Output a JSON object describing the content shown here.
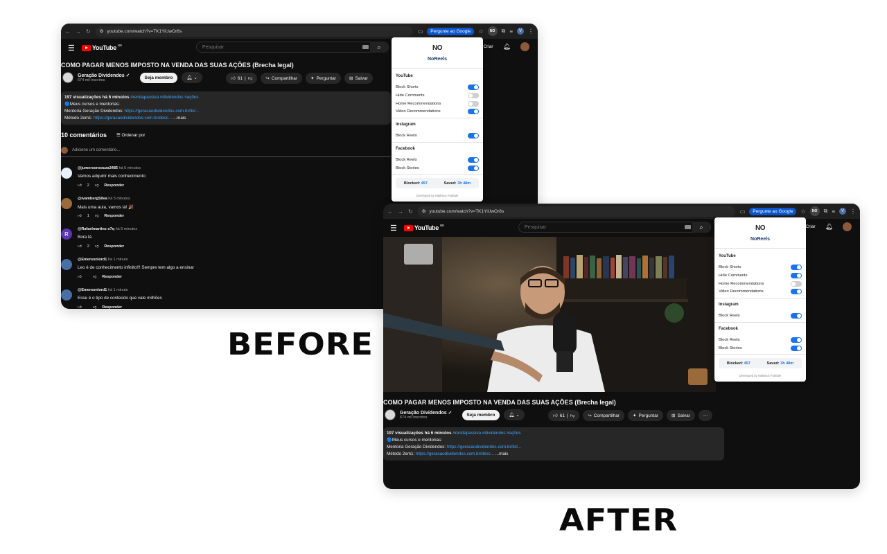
{
  "labels": {
    "before": "BEFORE",
    "after": "AFTER"
  },
  "browser": {
    "url": "youtube.com/watch?v=TK1YiUwOr8s",
    "ask_google": "Pergunte ao Google",
    "ext_badge": "NO"
  },
  "youtube": {
    "logo_text": "YouTube",
    "region": "BR",
    "search_placeholder": "Pesquisar",
    "create_label": "Criar",
    "video_title": "COMO PAGAR MENOS IMPOSTO NA VENDA DAS SUAS AÇÕES (Brecha legal)",
    "channel_name": "Geração Dividendos",
    "channel_subs": "674 mil inscritos",
    "join_label": "Seja membro",
    "like_count": "61",
    "share_label": "Compartilhar",
    "ask_label": "Perguntar",
    "save_label": "Salvar",
    "description": {
      "meta": "197 visualizações  há 6 minutos",
      "tags": "#rendapassiva #dividendos #ações",
      "line2": "🔵Meus cursos e mentorias:",
      "line3_prefix": "Mentoria Geração Dividendos: ",
      "line3_link": "https://geracaodividendos.com.br/list...",
      "line4_prefix": "Método 2em1: ",
      "line4_link": "https://geracaodividendos.com.br/desc...",
      "more": "...mais"
    },
    "comments_count": "10 comentários",
    "sort_label": "Ordenar por",
    "add_comment_placeholder": "Adicione um comentário...",
    "reply_label": "Responder",
    "comments": [
      {
        "author": "@jumersonsouza3485",
        "time": "há 5 minutos",
        "text": "Vamos adquirir mais conhecimento",
        "likes": "2",
        "avatar_color": "#e8f0fe",
        "avatar_letter": ""
      },
      {
        "author": "@ivambergSilva",
        "time": "há 5 minutos",
        "text": "Mais uma aula, vamos lá! 🎉",
        "likes": "1",
        "avatar_color": "#9c6b3c",
        "avatar_letter": ""
      },
      {
        "author": "@Rafaelmartins-x7q",
        "time": "há 5 minutos",
        "text": "Bora lá",
        "likes": "2",
        "avatar_color": "#5e35b1",
        "avatar_letter": "R"
      },
      {
        "author": "@Emersonlord1",
        "time": "há 1 minuto",
        "text": "Leo é de conhecimento infinito!!! Sempre tem algo a ensinar",
        "likes": "",
        "avatar_color": "#4a6fa5",
        "avatar_letter": ""
      },
      {
        "author": "@Emersonlord1",
        "time": "há 1 minuto",
        "text": "Esse é o tipo de conteúdo que vale milhões",
        "likes": "",
        "avatar_color": "#4a6fa5",
        "avatar_letter": ""
      }
    ]
  },
  "noreels": {
    "logo": "NO",
    "name": "NoReels",
    "sections": [
      {
        "title": "YouTube",
        "items": [
          {
            "label": "Block Shorts"
          },
          {
            "label": "Hide Comments"
          },
          {
            "label": "Home Recommendations"
          },
          {
            "label": "Video Recommendations"
          }
        ]
      },
      {
        "title": "Instagram",
        "items": [
          {
            "label": "Block Reels"
          }
        ]
      },
      {
        "title": "Facebook",
        "items": [
          {
            "label": "Block Reels"
          },
          {
            "label": "Block Stories"
          }
        ]
      }
    ],
    "states_before": [
      true,
      false,
      false,
      true,
      true,
      true,
      true
    ],
    "states_after": [
      true,
      true,
      false,
      true,
      true,
      true,
      true
    ],
    "blocked_label": "Blocked:",
    "blocked_value": "457",
    "saved_label": "Saved:",
    "saved_value": "3h 48m",
    "footer": "Developed by Matheus Fraktale"
  },
  "colors": {
    "accent": "#1a73e8",
    "yt_red": "#ff0000",
    "link": "#3ea6ff"
  }
}
